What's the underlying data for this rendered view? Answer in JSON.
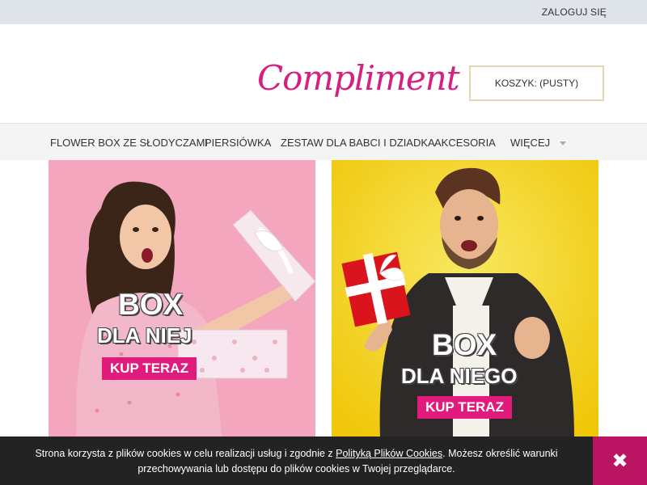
{
  "topbar": {
    "login_label": "ZALOGUJ SIĘ"
  },
  "header": {
    "logo_text": "Compliment",
    "cart_label": "KOSZYK: (PUSTY)"
  },
  "nav": {
    "items": [
      {
        "label": "FLOWER BOX ZE SŁODYCZAMI"
      },
      {
        "label": "PIERSIÓWKA"
      },
      {
        "label": "ZESTAW DLA BABCI I DZIADKA"
      },
      {
        "label": "AKCESORIA"
      },
      {
        "label": "WIĘCEJ"
      }
    ]
  },
  "banners": [
    {
      "title": "BOX",
      "subtitle": "DLA NIEJ",
      "cta": "KUP TERAZ",
      "bg_color": "#f3a6bd"
    },
    {
      "title": "BOX",
      "subtitle": "DLA NIEGO",
      "cta": "KUP TERAZ",
      "bg_color": "#f2d518"
    }
  ],
  "cookie": {
    "text_before": "Strona korzysta z plików cookies w celu realizacji usług i zgodnie z ",
    "link_label": "Polityką Plików Cookies",
    "text_after": ". Możesz określić warunki przechowywania lub dostępu do plików cookies w Twojej przeglądarce.",
    "close_label": "✖"
  },
  "colors": {
    "brand": "#d6207f",
    "cta": "#e01b7c",
    "cookie_bg": "#232323"
  }
}
